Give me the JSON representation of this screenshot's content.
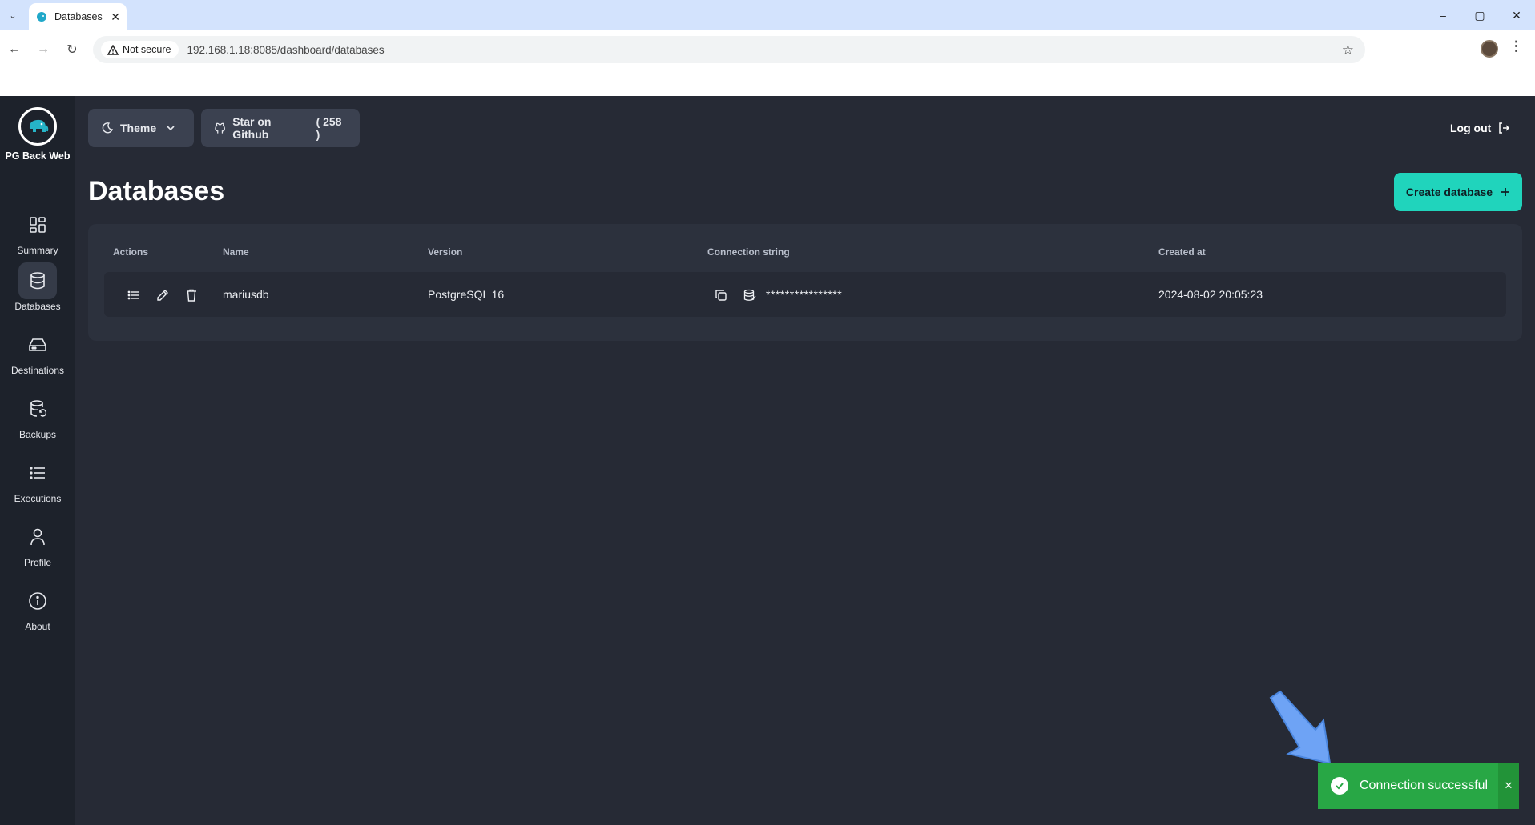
{
  "browser": {
    "tab_title": "Databases",
    "tab_close": "✕",
    "security_label": "Not secure",
    "url": "192.168.1.18:8085/dashboard/databases",
    "window_controls": [
      "–",
      "▢",
      "✕"
    ]
  },
  "app": {
    "brand_name": "PG Back Web",
    "nav": [
      {
        "label": "Summary",
        "icon": "grid-icon"
      },
      {
        "label": "Databases",
        "icon": "database-icon",
        "active": true
      },
      {
        "label": "Destinations",
        "icon": "hard-drive-icon"
      },
      {
        "label": "Backups",
        "icon": "database-backup-icon"
      },
      {
        "label": "Executions",
        "icon": "list-icon"
      },
      {
        "label": "Profile",
        "icon": "user-icon"
      },
      {
        "label": "About",
        "icon": "info-icon"
      }
    ],
    "theme_label": "Theme",
    "github_label": "Star on Github",
    "github_count": "( 258 )",
    "logout_label": "Log out",
    "page_title": "Databases",
    "create_label": "Create database",
    "table": {
      "headers": [
        "Actions",
        "Name",
        "Version",
        "Connection string",
        "Created at"
      ],
      "rows": [
        {
          "name": "mariusdb",
          "version": "PostgreSQL 16",
          "connection": "****************",
          "created_at": "2024-08-02 20:05:23"
        }
      ]
    },
    "toast": {
      "message": "Connection successful",
      "close": "✕"
    }
  },
  "colors": {
    "accent": "#20d4bc",
    "background": "#262a35",
    "sidebar": "#1d222b",
    "success": "#28a745",
    "annotation_arrow": "#6ea3f5"
  }
}
